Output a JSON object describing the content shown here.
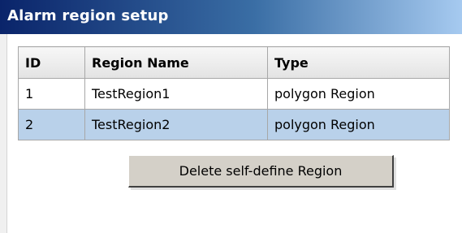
{
  "window": {
    "title": "Alarm region setup"
  },
  "table": {
    "columns": [
      "ID",
      "Region Name",
      "Type"
    ],
    "rows": [
      {
        "id": "1",
        "name": "TestRegion1",
        "type": "polygon Region",
        "selected": false
      },
      {
        "id": "2",
        "name": "TestRegion2",
        "type": "polygon Region",
        "selected": true
      }
    ]
  },
  "context_menu": {
    "items": [
      "Delete self-define Region"
    ]
  },
  "colors": {
    "titlebar_start": "#0a246a",
    "titlebar_end": "#a6caf0",
    "selection": "#b9d1ea",
    "menu_face": "#d4d0c8"
  }
}
